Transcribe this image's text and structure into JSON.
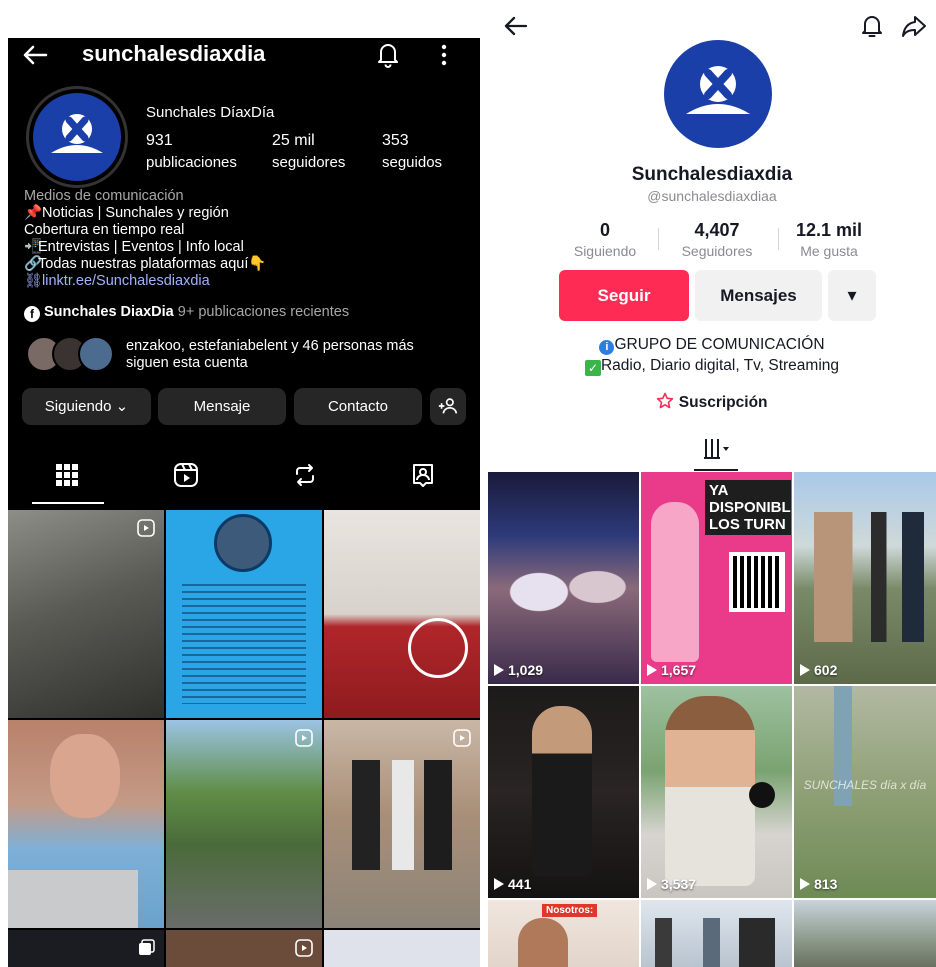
{
  "instagram": {
    "username": "sunchalesdiaxdia",
    "display_name": "Sunchales DíaxDía",
    "stats": [
      {
        "value": "931",
        "label": "publicaciones"
      },
      {
        "value": "25 mil",
        "label": "seguidores"
      },
      {
        "value": "353",
        "label": "seguidos"
      }
    ],
    "bio": {
      "category": "Medios de comunicación",
      "line1": "Noticias | Sunchales y región",
      "line2": "Cobertura en tiempo real",
      "line3": "Entrevistas | Eventos | Info local",
      "line4": "Todas nuestras plataformas aquí",
      "link": "linktr.ee/Sunchalesdiaxdia"
    },
    "facebook": {
      "name": "Sunchales DiaxDia",
      "recent": "9+ publicaciones recientes"
    },
    "followed_by": {
      "line1": "enzakoo, estefaniabelent y 46 personas más",
      "line2": "siguen esta cuenta"
    },
    "buttons": {
      "following": "Siguiendo ⌄",
      "message": "Mensaje",
      "contact": "Contacto"
    },
    "icons": [
      "back-arrow-icon",
      "bell-icon",
      "more-vertical-icon",
      "grid-icon",
      "reels-icon",
      "repost-icon",
      "tagged-icon",
      "add-person-icon"
    ]
  },
  "tiktok": {
    "display_name": "Sunchalesdiaxdia",
    "handle": "@sunchalesdiaxdiaa",
    "stats": [
      {
        "value": "0",
        "label": "Siguiendo"
      },
      {
        "value": "4,407",
        "label": "Seguidores"
      },
      {
        "value": "12.1 mil",
        "label": "Me gusta"
      }
    ],
    "buttons": {
      "follow": "Seguir",
      "messages": "Mensajes",
      "more": "▾"
    },
    "bio": {
      "line1": "GRUPO DE COMUNICACIÓN",
      "line2": "Radio, Diario digital, Tv, Streaming"
    },
    "subscription": "Suscripción",
    "videos": [
      {
        "views": "1,029"
      },
      {
        "views": "1,657"
      },
      {
        "views": "602"
      },
      {
        "views": "441"
      },
      {
        "views": "3,537"
      },
      {
        "views": "813"
      }
    ],
    "thumb_text": {
      "poster": "YA DISPONIBL LOS TURN",
      "nosotros": "Nosotros:",
      "watermark": "SUNCHALES día x día"
    },
    "colors": {
      "follow": "#fe2c55",
      "secondary_btn": "#f1f1f2",
      "avatar": "#1a3fa8"
    }
  }
}
